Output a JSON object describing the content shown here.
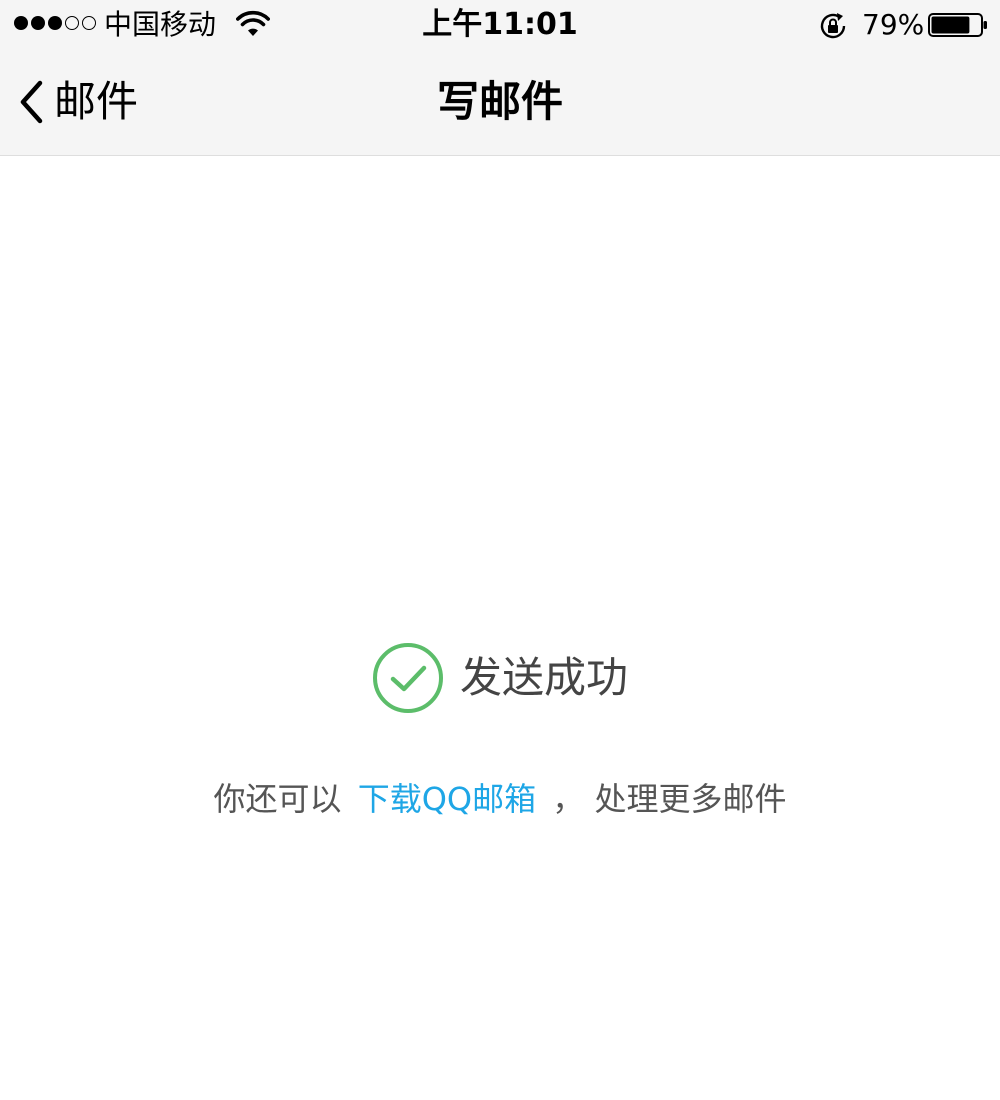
{
  "status_bar": {
    "signal": {
      "full_bars": 3,
      "total_bars": 5
    },
    "carrier": "中国移动",
    "wifi_icon": "wifi-icon",
    "time": "上午11:01",
    "orientation_lock_icon": "orientation-lock-icon",
    "battery_percent": "79%",
    "battery_level": 0.79
  },
  "nav": {
    "back_label": "邮件",
    "back_icon": "chevron-left-icon",
    "title": "写邮件"
  },
  "result": {
    "icon": "check-circle-icon",
    "icon_color": "#5cbd6a",
    "message": "发送成功"
  },
  "hint": {
    "prefix": "你还可以",
    "link": "下载QQ邮箱",
    "suffix": "， 处理更多邮件",
    "link_color": "#1ea6e6"
  }
}
